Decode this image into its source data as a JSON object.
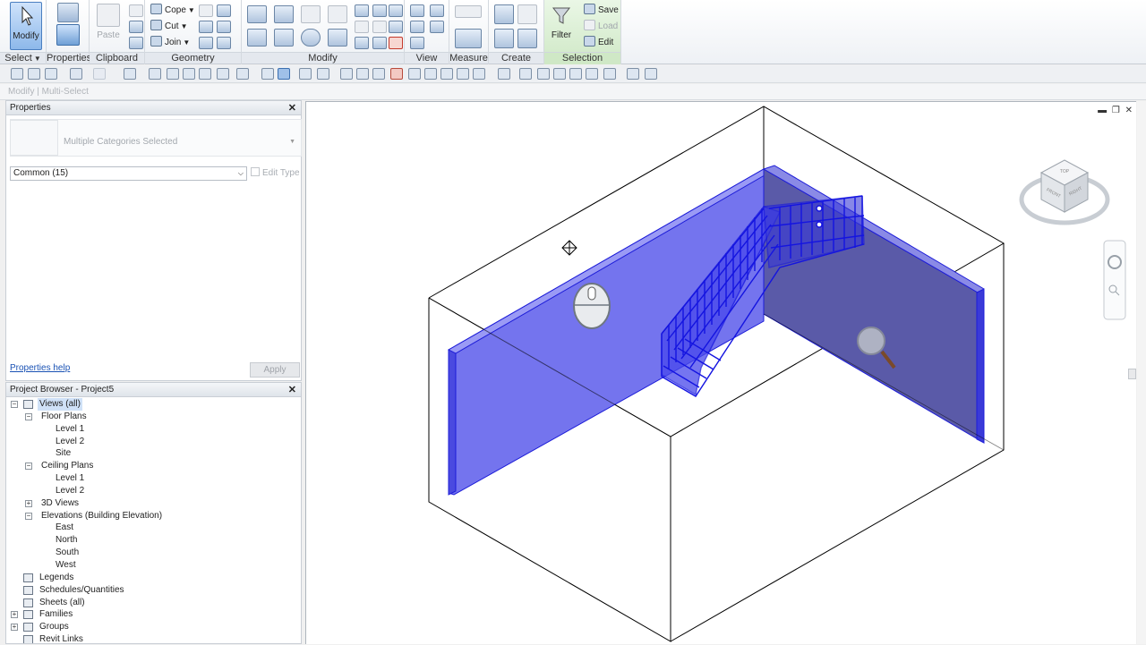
{
  "ribbon": {
    "modify_label": "Modify",
    "properties_label": "Properties",
    "paste_label": "Paste",
    "filter_label": "Filter",
    "cope_label": "Cope",
    "cut_label": "Cut",
    "join_label": "Join",
    "save_label": "Save",
    "load_label": "Load",
    "edit_label": "Edit",
    "groups": {
      "select": "Select",
      "properties": "Properties",
      "clipboard": "Clipboard",
      "geometry": "Geometry",
      "modify": "Modify",
      "view": "View",
      "measure": "Measure",
      "create": "Create",
      "selection": "Selection"
    }
  },
  "options_bar": {
    "context": "Modify | Multi-Select"
  },
  "properties_panel": {
    "title": "Properties",
    "type_name": "Multiple Categories Selected",
    "filter_value": "Common (15)",
    "edit_type": "Edit Type",
    "help_link": "Properties help",
    "apply": "Apply"
  },
  "project_browser": {
    "title": "Project Browser - Project5",
    "items": [
      {
        "label": "Views (all)",
        "level": 0,
        "toggle": "−",
        "icon": true,
        "selected": true
      },
      {
        "label": "Floor Plans",
        "level": 1,
        "toggle": "−"
      },
      {
        "label": "Level 1",
        "level": 2
      },
      {
        "label": "Level 2",
        "level": 2
      },
      {
        "label": "Site",
        "level": 2
      },
      {
        "label": "Ceiling Plans",
        "level": 1,
        "toggle": "−"
      },
      {
        "label": "Level 1",
        "level": 2
      },
      {
        "label": "Level 2",
        "level": 2
      },
      {
        "label": "3D Views",
        "level": 1,
        "toggle": "+"
      },
      {
        "label": "Elevations (Building Elevation)",
        "level": 1,
        "toggle": "−"
      },
      {
        "label": "East",
        "level": 2
      },
      {
        "label": "North",
        "level": 2
      },
      {
        "label": "South",
        "level": 2
      },
      {
        "label": "West",
        "level": 2
      },
      {
        "label": "Legends",
        "level": 0,
        "icon": true
      },
      {
        "label": "Schedules/Quantities",
        "level": 0,
        "icon": true
      },
      {
        "label": "Sheets (all)",
        "level": 0,
        "icon": true
      },
      {
        "label": "Families",
        "level": 0,
        "toggle": "+",
        "icon": true
      },
      {
        "label": "Groups",
        "level": 0,
        "toggle": "+",
        "icon": true
      },
      {
        "label": "Revit Links",
        "level": 0,
        "icon": true
      }
    ]
  },
  "viewcube": {
    "top": "TOP",
    "front": "FRONT",
    "right": "RIGHT"
  },
  "colors": {
    "selection": "#2f2ff0",
    "wall_fill": "#6e6ef0"
  }
}
